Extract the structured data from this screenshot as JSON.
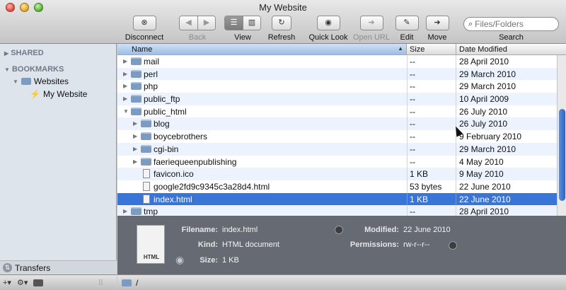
{
  "window": {
    "title": "My Website"
  },
  "toolbar": {
    "disconnect": "Disconnect",
    "back": "Back",
    "view": "View",
    "refresh": "Refresh",
    "quick_look": "Quick Look",
    "open_url": "Open URL",
    "edit": "Edit",
    "move": "Move",
    "search_placeholder": "Files/Folders",
    "search_label": "Search"
  },
  "sidebar": {
    "shared": "SHARED",
    "bookmarks": "BOOKMARKS",
    "websites": "Websites",
    "my_website": "My Website",
    "transfers": "Transfers"
  },
  "columns": {
    "name": "Name",
    "size": "Size",
    "date": "Date Modified"
  },
  "rows": [
    {
      "name": "mail",
      "size": "--",
      "date": "28 April 2010"
    },
    {
      "name": "perl",
      "size": "--",
      "date": "29 March 2010"
    },
    {
      "name": "php",
      "size": "--",
      "date": "29 March 2010"
    },
    {
      "name": "public_ftp",
      "size": "--",
      "date": "10 April 2009"
    },
    {
      "name": "public_html",
      "size": "--",
      "date": "26 July 2010"
    },
    {
      "name": "blog",
      "size": "--",
      "date": "26 July 2010"
    },
    {
      "name": "boycebrothers",
      "size": "--",
      "date": "9 February 2010"
    },
    {
      "name": "cgi-bin",
      "size": "--",
      "date": "29 March 2010"
    },
    {
      "name": "faeriequeenpublishing",
      "size": "--",
      "date": "4 May 2010"
    },
    {
      "name": "favicon.ico",
      "size": "1 KB",
      "date": "9 May 2010"
    },
    {
      "name": "google2fd9c9345c3a28d4.html",
      "size": "53 bytes",
      "date": "22 June 2010"
    },
    {
      "name": "index.html",
      "size": "1 KB",
      "date": "22 June 2010"
    },
    {
      "name": "tmp",
      "size": "--",
      "date": "28 April 2010"
    }
  ],
  "info": {
    "icon_label": "HTML",
    "filename_label": "Filename:",
    "filename": "index.html",
    "kind_label": "Kind:",
    "kind": "HTML document",
    "size_label": "Size:",
    "size": "1 KB",
    "modified_label": "Modified:",
    "modified": "22 June 2010",
    "permissions_label": "Permissions:",
    "permissions": "rw-r--r--"
  },
  "path": {
    "current": "/"
  }
}
